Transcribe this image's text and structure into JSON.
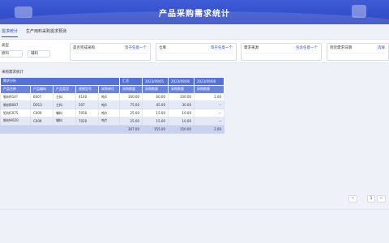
{
  "app": {
    "title": "产品采购需求统计"
  },
  "tabs": [
    {
      "label": "需求统计",
      "active": true
    },
    {
      "label": "生产用料采购需求预测",
      "active": false
    }
  ],
  "filters": {
    "type_label": "类型",
    "type_options": [
      "原料",
      "辅料"
    ],
    "fields": [
      {
        "label": "是否完成采购",
        "value": "等于任意一个"
      },
      {
        "label": "仓库",
        "value": "等于任意一个"
      },
      {
        "label": "需求来源",
        "value": "包含任意一个"
      },
      {
        "label": "到货需求日期",
        "value": "选择"
      }
    ]
  },
  "section": {
    "label": "采购需求统计"
  },
  "table": {
    "group_headers": [
      "需求分析",
      "汇总",
      "2023/09/05",
      "2023/09/06",
      "2023/09/08"
    ],
    "columns": [
      "产品名称",
      "产品编码",
      "产品类型",
      "规格型号",
      "采购单位",
      "采购数量",
      "采购数量",
      "采购数量",
      "采购数量"
    ],
    "rows": [
      [
        "钢材A14?",
        "E607",
        "主料",
        "4140",
        "吨/t",
        "160.00",
        "60.00",
        "100.00",
        "2.00"
      ],
      [
        "钢材B087",
        "D013",
        "主料",
        "507",
        "吨/t",
        "75.00",
        "45.00",
        "30.00",
        "--"
      ],
      [
        "铝材C075",
        "C009",
        "辅料",
        "7050",
        "吨/t",
        "25.00",
        "15.00",
        "10.00",
        "--"
      ],
      [
        "钢材H020",
        "C009",
        "辅料",
        "7020",
        "吨/t",
        "25.00",
        "15.00",
        "10.00",
        "--"
      ]
    ],
    "totals": [
      "",
      "",
      "",
      "",
      "",
      "307.00",
      "155.00",
      "150.00",
      "2.00"
    ]
  },
  "pagination": {
    "prev": "<",
    "page": "1",
    "next": ">"
  },
  "colors": {
    "banner": "#2f48c4",
    "header": "#5671d6",
    "accent": "#2f48c4"
  }
}
